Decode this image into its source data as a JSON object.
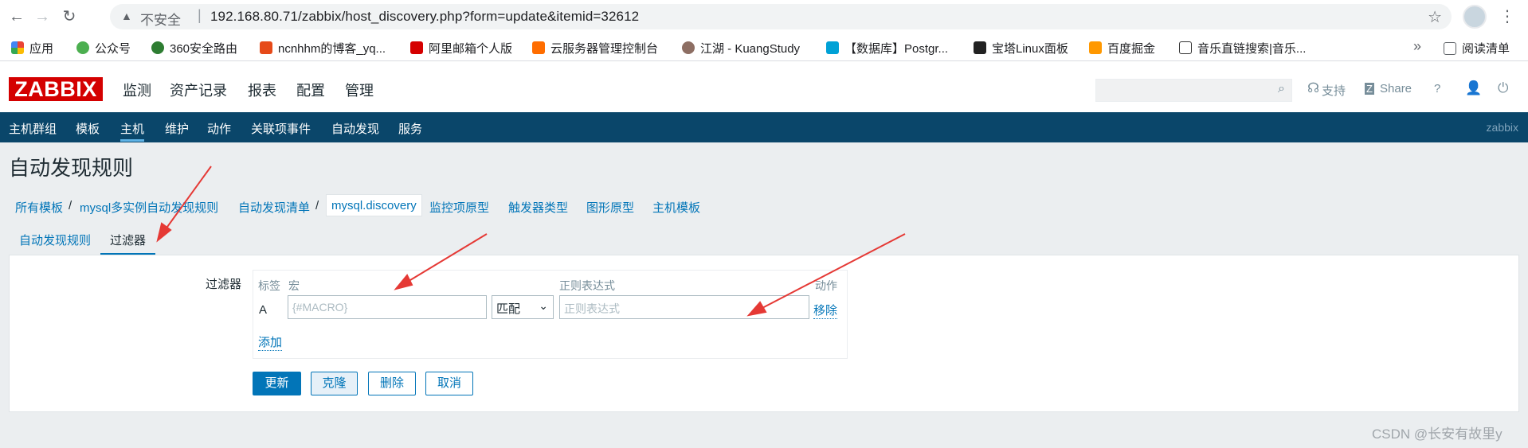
{
  "browser": {
    "insecure_label": "不安全",
    "separator": "|",
    "url": "192.168.80.71/zabbix/host_discovery.php?form=update&itemid=32612",
    "bookmarks": [
      "应用",
      "公众号",
      "360安全路由",
      "ncnhhm的博客_yq...",
      "阿里邮箱个人版",
      "云服务器管理控制台",
      "江湖 - KuangStudy",
      "【数据库】Postgr...",
      "宝塔Linux面板",
      "百度掘金",
      "音乐直链搜索|音乐..."
    ],
    "bookmarks_more": "»",
    "reading_list": "阅读清单"
  },
  "zabbix": {
    "logo": "ZABBIX",
    "menu": [
      "监测",
      "资产记录",
      "报表",
      "配置",
      "管理"
    ],
    "support": "支持",
    "share": "Share",
    "help": "?",
    "submenu": [
      "主机群组",
      "模板",
      "主机",
      "维护",
      "动作",
      "关联项事件",
      "自动发现",
      "服务"
    ],
    "server_name": "zabbix"
  },
  "page": {
    "title": "自动发现规则",
    "breadcrumbs": [
      "所有模板",
      "mysql多实例自动发现规则",
      "自动发现清单",
      "mysql.discovery",
      "监控项原型",
      "触发器类型",
      "图形原型",
      "主机模板"
    ],
    "breadcrumb_sep": "/",
    "tabs": [
      "自动发现规则",
      "过滤器"
    ],
    "filter": {
      "label": "过滤器",
      "col_label": "标签",
      "col_macro": "宏",
      "col_regex": "正则表达式",
      "col_action": "动作",
      "row_letter": "A",
      "macro_placeholder": "{#MACRO}",
      "operator": "匹配",
      "regex_placeholder": "正则表达式",
      "remove": "移除",
      "add": "添加"
    },
    "buttons": [
      "更新",
      "克隆",
      "删除",
      "取消"
    ]
  },
  "watermark": "CSDN @长安有故里y",
  "colors": {
    "zabbix_red": "#d40000",
    "subnav_bg": "#0a466a",
    "link_blue": "#0275b8",
    "annotation_red": "#e53935"
  }
}
